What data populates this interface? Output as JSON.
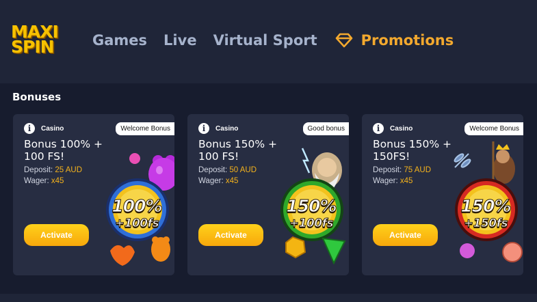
{
  "header": {
    "logo_text": [
      "MAXI",
      "SPIN"
    ],
    "nav": [
      {
        "label": "Games"
      },
      {
        "label": "Live"
      },
      {
        "label": "Virtual Sport"
      },
      {
        "label": "Promotions",
        "icon": "diamond-icon",
        "active": true
      }
    ]
  },
  "section": {
    "title": "Bonuses"
  },
  "cards": [
    {
      "tag": "Casino",
      "badge": "Welcome Bonus",
      "title": "Bonus 100% + 100 FS!",
      "deposit_label": "Deposit:",
      "deposit_value": "25 AUD",
      "wager_label": "Wager:",
      "wager_value": "x45",
      "button": "Activate",
      "coin": {
        "big": "100%",
        "small": "+100fs"
      }
    },
    {
      "tag": "Casino",
      "badge": "Good bonus",
      "title": "Bonus 150% + 100 FS!",
      "deposit_label": "Deposit:",
      "deposit_value": "50 AUD",
      "wager_label": "Wager:",
      "wager_value": "x45",
      "button": "Activate",
      "coin": {
        "big": "150%",
        "small": "+100fs"
      }
    },
    {
      "tag": "Casino",
      "badge": "Welcome Bonus",
      "title": "Bonus 150% + 150FS!",
      "deposit_label": "Deposit:",
      "deposit_value": "75 AUD",
      "wager_label": "Wager:",
      "wager_value": "x45",
      "button": "Activate",
      "coin": {
        "big": "150%",
        "small": "+150fs"
      }
    }
  ],
  "colors": {
    "background": "#171c2e",
    "header": "#1f2538",
    "card": "#272d42",
    "accent": "#f3a92e",
    "logo": "#f7c200",
    "coin_ring_1": "#2f6fd8",
    "coin_ring_2": "#2fa82a",
    "coin_ring_3": "#d62a22"
  }
}
